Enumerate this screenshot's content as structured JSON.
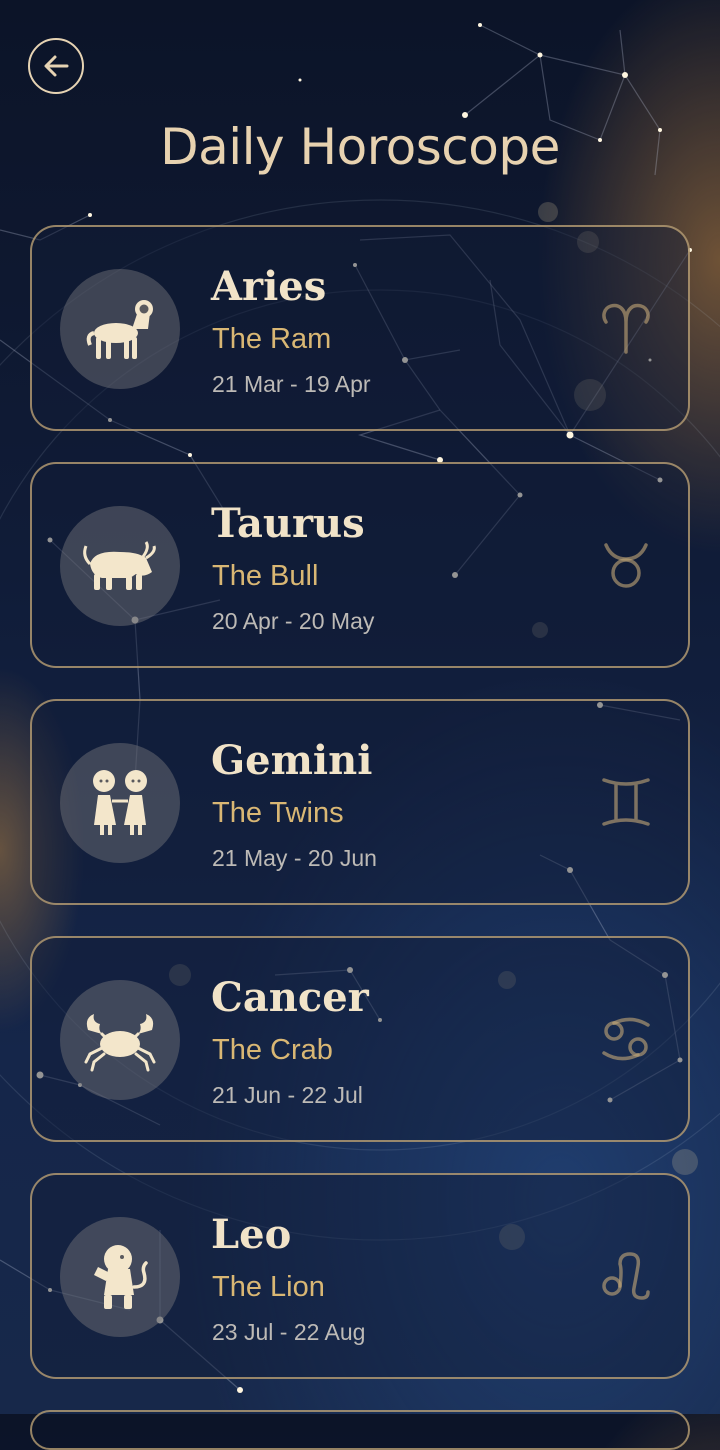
{
  "header": {
    "back_icon": "arrow-left-icon",
    "title": "Daily Horoscope"
  },
  "colors": {
    "title": "#e7d2b0",
    "accent_gold": "#d9b774",
    "card_border": "#c4a878",
    "background": "#101c38"
  },
  "signs": [
    {
      "name": "Aries",
      "subtitle": "The Ram",
      "dates": "21 Mar - 19 Apr",
      "icon": "ram-icon",
      "symbol_icon": "aries-symbol-icon"
    },
    {
      "name": "Taurus",
      "subtitle": "The Bull",
      "dates": "20 Apr - 20 May",
      "icon": "bull-icon",
      "symbol_icon": "taurus-symbol-icon"
    },
    {
      "name": "Gemini",
      "subtitle": "The Twins",
      "dates": "21 May - 20 Jun",
      "icon": "twins-icon",
      "symbol_icon": "gemini-symbol-icon"
    },
    {
      "name": "Cancer",
      "subtitle": "The Crab",
      "dates": "21 Jun - 22 Jul",
      "icon": "crab-icon",
      "symbol_icon": "cancer-symbol-icon"
    },
    {
      "name": "Leo",
      "subtitle": "The Lion",
      "dates": "23 Jul - 22 Aug",
      "icon": "lion-icon",
      "symbol_icon": "leo-symbol-icon"
    }
  ]
}
